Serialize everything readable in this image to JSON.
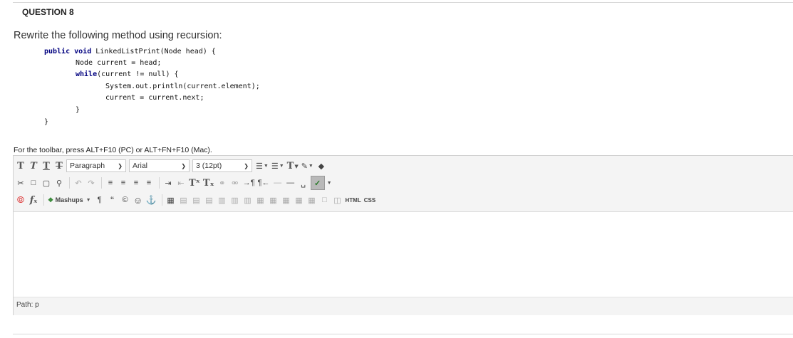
{
  "question": {
    "header": "QUESTION 8",
    "prompt": "Rewrite the following method using recursion:"
  },
  "code_lines": [
    "public void LinkedListPrint(Node head) {",
    "Node current = head;",
    "while(current != null) {",
    "System.out.println(current.element);",
    "current = current.next;",
    "}",
    "}"
  ],
  "editor": {
    "toolbar_hint": "For the toolbar, press ALT+F10 (PC) or ALT+FN+F10 (Mac).",
    "paragraph_select": "Paragraph",
    "font_select": "Arial",
    "size_select": "3 (12pt)",
    "mashups_label": "Mashups",
    "html_label": "HTML",
    "css_label": "CSS",
    "path_label": "Path: p"
  }
}
